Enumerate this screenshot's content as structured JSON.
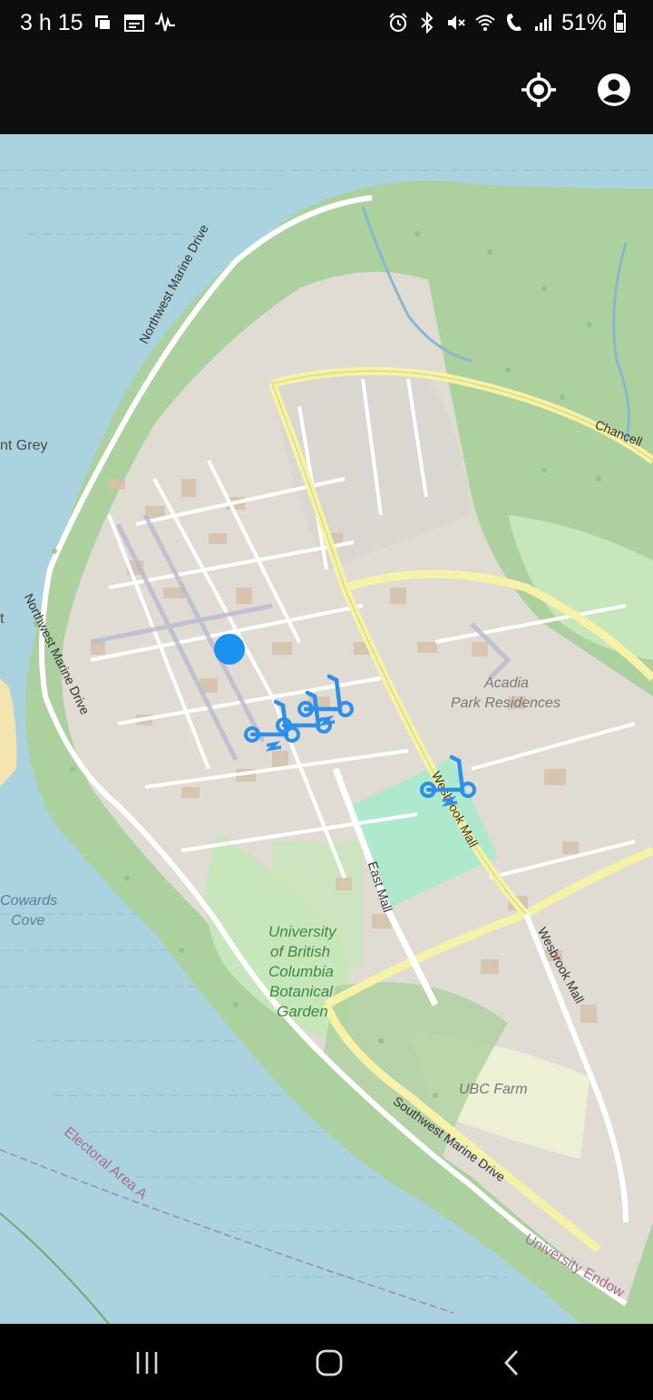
{
  "status_bar": {
    "time": "3 h 15",
    "battery_text": "51%",
    "battery_level": 0.51,
    "left_icons": [
      "notification-icon",
      "calendar-icon",
      "activity-icon"
    ],
    "right_icons": [
      "alarm-icon",
      "bluetooth-icon",
      "mute-icon",
      "wifi-calling-icon",
      "volte-icon",
      "signal-icon"
    ]
  },
  "app_bar": {
    "buttons": [
      "my-location-icon",
      "account-icon"
    ],
    "background": "#0f0f0f"
  },
  "map": {
    "labels": {
      "northwest_marine_drive_top": "Northwest Marine Drive",
      "northwest_marine_drive_left": "Northwest Marine Drive",
      "point_grey": "nt Grey",
      "point_t": "t",
      "chancellor": "Chancell",
      "acadia_1": "Acadia",
      "acadia_2": "Park Residences",
      "wesbrook_upper": "Wesbrook Mall",
      "wesbrook_lower": "Wesbrook Mall",
      "east_mall": "East Mall",
      "garden_1": "University",
      "garden_2": "of British",
      "garden_3": "Columbia",
      "garden_4": "Botanical",
      "garden_5": "Garden",
      "cowards_1": "Cowards",
      "cowards_2": "Cove",
      "ubc_farm": "UBC Farm",
      "southwest_marine": "Southwest Marine Drive",
      "electoral": "Electoral Area A",
      "university_endowment": "University Endow"
    },
    "colors": {
      "water": "#aad3df",
      "land": "#f2efe9",
      "park": "#c8e6bc",
      "forest": "#add19e",
      "campus": "#e0dcd4",
      "building": "#d9c9b8",
      "main_road": "#f6f3a8",
      "user_location": "#1a93f0",
      "scooter": "#2d8fe8"
    },
    "scooters": [
      {
        "label": "scooter-1",
        "charging": true
      },
      {
        "label": "scooter-2",
        "charging": false
      },
      {
        "label": "scooter-3",
        "charging": true
      },
      {
        "label": "scooter-4",
        "charging": true
      }
    ]
  },
  "nav_bar": {
    "buttons": [
      "recents-icon",
      "home-icon",
      "back-icon"
    ]
  }
}
